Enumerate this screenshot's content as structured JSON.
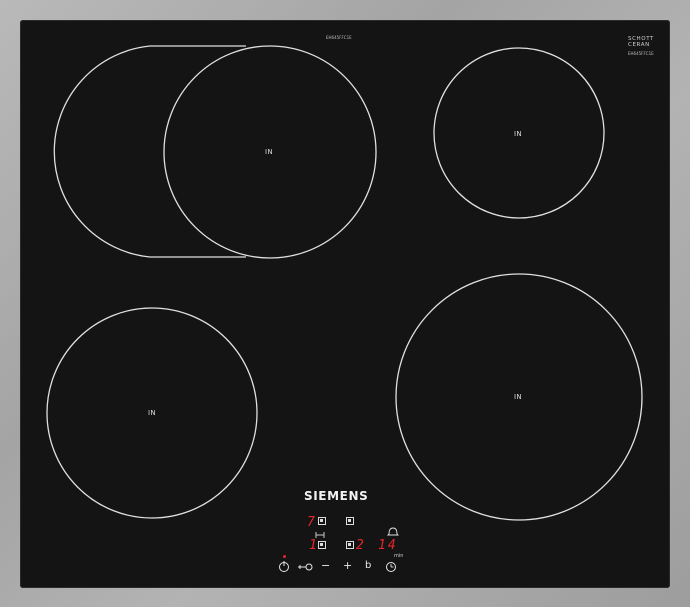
{
  "cooktop": {
    "model_top": "EH645FFC1E",
    "schott_line1": "SCHOTT",
    "schott_line2": "CERAN",
    "schott_model": "EH645FFC1E",
    "brand": "SIEMENS",
    "zone_label": "IN",
    "colors": {
      "glass": "#141414",
      "zone_line": "#e0e0e0",
      "display": "#e2262a",
      "frame": "#a8a8a8"
    }
  },
  "zones": [
    {
      "name": "zone-top-left",
      "label": "IN"
    },
    {
      "name": "zone-top-right",
      "label": "IN"
    },
    {
      "name": "zone-bottom-left",
      "label": "IN"
    },
    {
      "name": "zone-bottom-right",
      "label": "IN"
    }
  ],
  "displays": {
    "top_left": "7",
    "bottom_left": "1",
    "bottom_mid": "2",
    "timer": "14",
    "timer_unit": "min"
  },
  "controls": {
    "power_icon": "power-icon",
    "lock_icon": "key-lock-icon",
    "minus": "−",
    "plus": "+",
    "boost": "b",
    "timer_icon": "clock-icon",
    "bell_icon": "bell-icon",
    "link_icon": "link-icon"
  }
}
